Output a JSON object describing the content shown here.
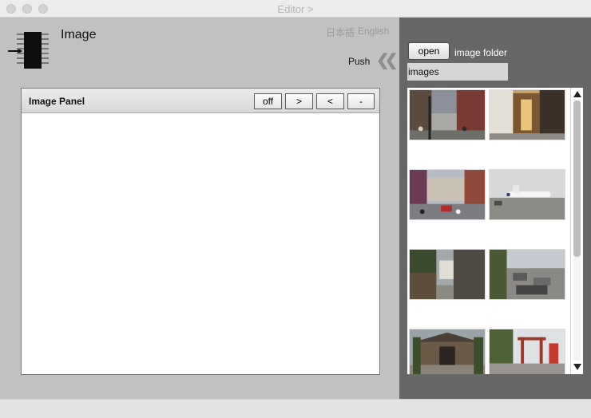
{
  "window": {
    "title": "Editor >"
  },
  "header": {
    "app_name": "Image",
    "lang_ja": "日本語",
    "lang_en": "English",
    "push_label": "Push",
    "push_icon": "double-chevron-left-icon"
  },
  "panel": {
    "title": "Image Panel",
    "buttons": [
      "off",
      ">",
      "<",
      "-"
    ]
  },
  "sidebar": {
    "open_label": "open",
    "folder_label": "image folder",
    "folder_path": "images"
  },
  "thumbnails": [
    {
      "name": "thumb-street-1"
    },
    {
      "name": "thumb-shop-entrance"
    },
    {
      "name": "thumb-street-crowd"
    },
    {
      "name": "thumb-airplane"
    },
    {
      "name": "thumb-alley-wall"
    },
    {
      "name": "thumb-city-view"
    },
    {
      "name": "thumb-temple-gate"
    },
    {
      "name": "thumb-shrine"
    }
  ],
  "colors": {
    "sidebar_bg": "#676767",
    "main_bg": "#c1c1c1",
    "panel_bg": "#ffffff"
  }
}
